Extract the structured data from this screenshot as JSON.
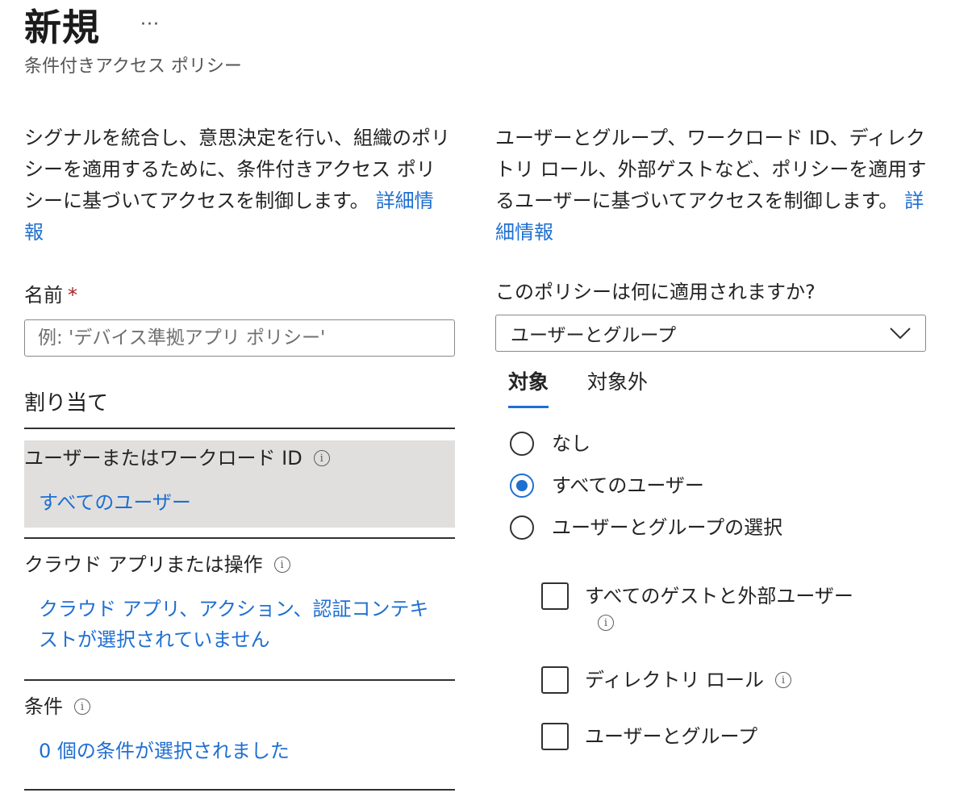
{
  "header": {
    "title": "新規",
    "more": "···",
    "subtitle": "条件付きアクセス ポリシー"
  },
  "left": {
    "description": "シグナルを統合し、意思決定を行い、組織のポリシーを適用するために、条件付きアクセス ポリシーに基づいてアクセスを制御します。",
    "learn_more": "詳細情報",
    "name_label": "名前",
    "required_mark": "*",
    "name_placeholder": "例: 'デバイス準拠アプリ ポリシー'",
    "name_value": "",
    "assignments_heading": "割り当て",
    "sections": [
      {
        "title": "ユーザーまたはワークロード ID",
        "value": "すべてのユーザー",
        "selected": true
      },
      {
        "title": "クラウド アプリまたは操作",
        "value": "クラウド アプリ、アクション、認証コンテキストが選択されていません",
        "selected": false
      },
      {
        "title": "条件",
        "value": "0 個の条件が選択されました",
        "selected": false
      }
    ]
  },
  "right": {
    "description": "ユーザーとグループ、ワークロード ID、ディレクトリ ロール、外部ゲストなど、ポリシーを適用するユーザーに基づいてアクセスを制御します。",
    "learn_more": "詳細情報",
    "applies_label": "このポリシーは何に適用されますか?",
    "applies_value": "ユーザーとグループ",
    "tabs": [
      {
        "label": "対象",
        "active": true
      },
      {
        "label": "対象外",
        "active": false
      }
    ],
    "radios": [
      {
        "label": "なし",
        "checked": false
      },
      {
        "label": "すべてのユーザー",
        "checked": true
      },
      {
        "label": "ユーザーとグループの選択",
        "checked": false
      }
    ],
    "checkboxes": [
      {
        "label": "すべてのゲストと外部ユーザー",
        "checked": false
      },
      {
        "label": "ディレクトリ ロール",
        "checked": false
      },
      {
        "label": "ユーザーとグループ",
        "checked": false
      }
    ]
  },
  "colors": {
    "accent": "#1f6fd1",
    "selected_bg": "#e1dfdd",
    "required": "#a4262c"
  },
  "icons": {
    "more": "more-icon",
    "info": "info-icon",
    "chevron": "chevron-down-icon"
  }
}
